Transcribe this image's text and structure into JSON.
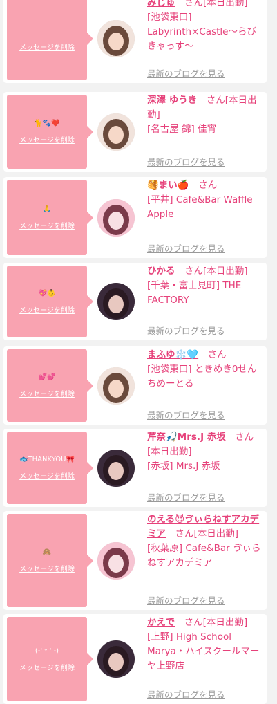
{
  "delete_label": "メッセージを削除",
  "blog_label": "最新のブログを見る",
  "san_label": "さん",
  "colors": {
    "accent": "#e6417a",
    "bubble": "#f9a3b1",
    "link_gray": "#999999"
  },
  "cards": [
    {
      "message": "",
      "name": "みじゅ",
      "status": "さん[本日出勤]",
      "shop": "[池袋東口] Labyrinth×Castle〜らびきゃっす〜",
      "avatar_theme": "light"
    },
    {
      "message": "🐈🐾❤️",
      "name": "深澤 ゆうき",
      "status": "さん[本日出勤]",
      "shop": "[名古屋 錦] 佳宵",
      "avatar_theme": "light"
    },
    {
      "message": "🙏",
      "name": "🥞まい🍎",
      "status": "さん",
      "shop": "[平井] Cafe&Bar Waffle Apple",
      "avatar_theme": "pink"
    },
    {
      "message": "💖👶",
      "name": "ひかる",
      "status": "さん[本日出勤]",
      "shop": "[千葉・富士見町] THE FACTORY",
      "avatar_theme": "dark"
    },
    {
      "message": "💕💕",
      "name": "まふゆ❄️🩵",
      "status": "さん",
      "shop": "[池袋東口] ときめき0せんちめーとる",
      "avatar_theme": "light"
    },
    {
      "message": "🐟THANKYOU🎀",
      "name": "芹奈🎣Mrs.J 赤坂",
      "status": "さん[本日出勤]",
      "shop": "[赤坂] Mrs.J 赤坂",
      "avatar_theme": "dark"
    },
    {
      "message": "🙈",
      "name": "のえる😈ゔぃらねすアカデミア",
      "status": "さん[本日出勤]",
      "shop": "[秋葉原] Cafe&Bar ゔぃらねすアカデミア",
      "avatar_theme": "pink"
    },
    {
      "message": "(-' ᵕ ' -)",
      "name": "かえで",
      "status": "さん[本日出勤]",
      "shop": "[上野] High School Marya・ハイスクールマーヤ上野店",
      "avatar_theme": "dark"
    }
  ]
}
